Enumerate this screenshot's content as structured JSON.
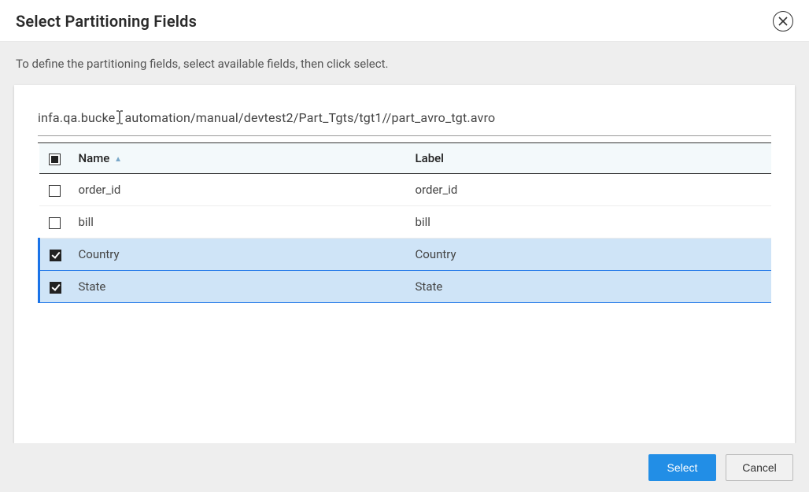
{
  "dialog": {
    "title": "Select Partitioning Fields",
    "instruction": "To define the partitioning fields, select available fields, then click select.",
    "path_pre": "infa.qa.bucke",
    "path_post": "automation/manual/devtest2/Part_Tgts/tgt1//part_avro_tgt.avro"
  },
  "table": {
    "header_name": "Name",
    "header_label": "Label",
    "select_all_state": "indeterminate",
    "sort": "asc",
    "rows": [
      {
        "name": "order_id",
        "label": "order_id",
        "checked": false
      },
      {
        "name": "bill",
        "label": "bill",
        "checked": false
      },
      {
        "name": "Country",
        "label": "Country",
        "checked": true
      },
      {
        "name": "State",
        "label": "State",
        "checked": true
      }
    ]
  },
  "footer": {
    "select": "Select",
    "cancel": "Cancel"
  }
}
